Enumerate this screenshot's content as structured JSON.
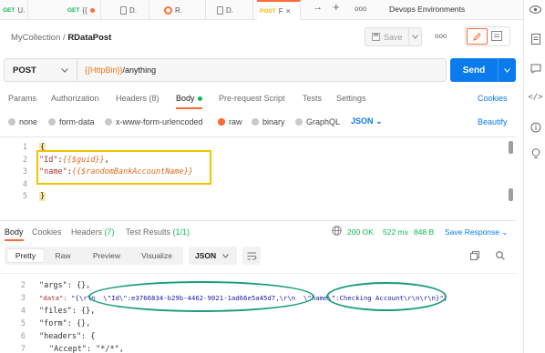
{
  "tabs": [
    {
      "method": "GET",
      "title": "U.",
      "icon": "dot"
    },
    {
      "method": "GET",
      "title": "{{",
      "icon": "dot"
    },
    {
      "method": "",
      "title": "D.",
      "icon": "doc"
    },
    {
      "method": "",
      "title": "R.",
      "icon": "orb"
    },
    {
      "method": "",
      "title": "D.",
      "icon": "doc"
    },
    {
      "method": "POST",
      "title": "F",
      "icon": "",
      "active": true
    }
  ],
  "environment": "Devops Environments",
  "breadcrumb": {
    "collection": "MyCollection",
    "separator": "/",
    "request": "RDataPost"
  },
  "save_label": "Save",
  "request": {
    "method": "POST",
    "url_var": "{{HttpBin}}",
    "url_path": "/anything",
    "send_label": "Send"
  },
  "request_tabs": {
    "params": "Params",
    "authorization": "Authorization",
    "headers": "Headers (8)",
    "body": "Body",
    "prescript": "Pre-request Script",
    "tests": "Tests",
    "settings": "Settings",
    "cookies": "Cookies"
  },
  "body_types": {
    "none": "none",
    "formdata": "form-data",
    "urlencoded": "x-www-form-urlencoded",
    "raw": "raw",
    "binary": "binary",
    "graphql": "GraphQL",
    "format": "JSON",
    "beautify": "Beautify"
  },
  "request_body": {
    "line_numbers": [
      "1",
      "2",
      "3",
      "4",
      "5"
    ],
    "l1": "{",
    "l2_key": "\"Id\"",
    "l2_sep": ":",
    "l2_val": "{{$guid}}",
    "l2_end": ",",
    "l3_key": "\"name\"",
    "l3_sep": ":",
    "l3_val": "{{$randomBankAccountName}}",
    "l5": "}"
  },
  "response_tabs": {
    "body": "Body",
    "cookies": "Cookies",
    "headers": "Headers",
    "headers_count": "(7)",
    "tests": "Test Results",
    "tests_count": "(1/1)"
  },
  "response_status": {
    "code": "200 OK",
    "time": "522 ms",
    "size": "848 B",
    "save": "Save Response"
  },
  "view_modes": {
    "pretty": "Pretty",
    "raw": "Raw",
    "preview": "Preview",
    "visualize": "Visualize"
  },
  "response_format": "JSON",
  "response_body": {
    "line_numbers": [
      "2",
      "3",
      "4",
      "5",
      "6",
      "7"
    ],
    "l2": "\"args\": {},",
    "l3_key": "\"data\": ",
    "l3_val": "\"{\\r\\n  \\\"Id\\\":e3766834-b29b-4462-9021-1ad66e5a45d7,\\r\\n  \\\"name\\\":Checking Account\\r\\n\\r\\n}\",",
    "l4": "\"files\": {},",
    "l5": "\"form\": {},",
    "l6": "\"headers\": {",
    "l7": "\"Accept\": \"*/*\","
  }
}
